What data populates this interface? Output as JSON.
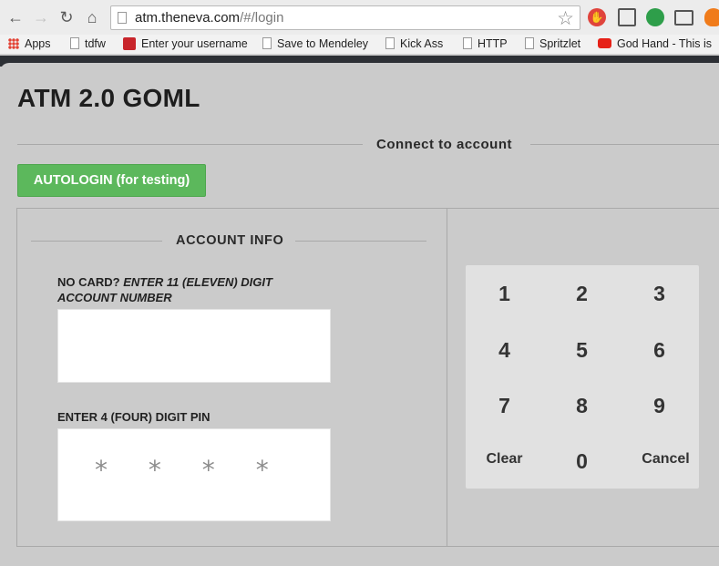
{
  "browser": {
    "url_host": "atm.theneva.com",
    "url_path": "/#/login",
    "bookmarks": [
      {
        "label": "Apps"
      },
      {
        "label": "tdfw"
      },
      {
        "label": "Enter your username"
      },
      {
        "label": "Save to Mendeley"
      },
      {
        "label": "Kick Ass"
      },
      {
        "label": "HTTP"
      },
      {
        "label": "Spritzlet"
      },
      {
        "label": "God Hand - This is"
      }
    ]
  },
  "app": {
    "title": "ATM 2.0 GOML",
    "section_title": "Connect to account",
    "autologin_label": "AUTOLOGIN (for testing)"
  },
  "account": {
    "title": "ACCOUNT INFO",
    "card_label_prefix": "NO CARD?",
    "card_label_emph_line1": "ENTER 11 (ELEVEN) DIGIT",
    "card_label_emph_line2": "ACCOUNT NUMBER",
    "account_number_value": "",
    "pin_label": "ENTER 4 (FOUR) DIGIT PIN",
    "pin_mask": "* * * *"
  },
  "keypad": {
    "keys": [
      "1",
      "2",
      "3",
      "4",
      "5",
      "6",
      "7",
      "8",
      "9",
      "Clear",
      "0",
      "Cancel"
    ]
  }
}
